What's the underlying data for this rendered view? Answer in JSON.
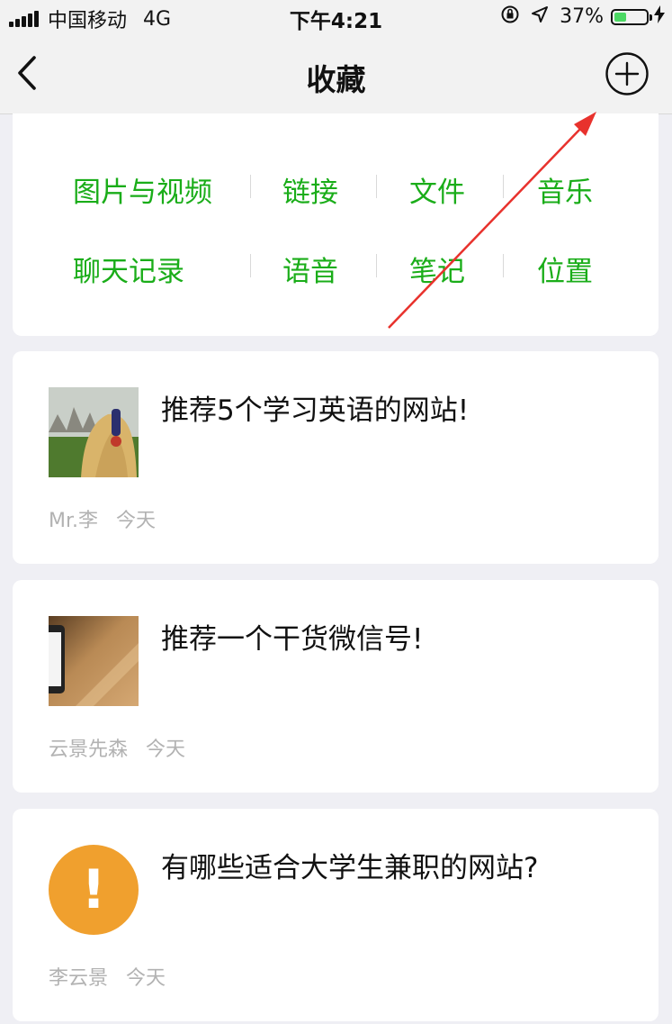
{
  "status_bar": {
    "carrier": "中国移动",
    "network": "4G",
    "time": "下午4:21",
    "battery_percent": "37%",
    "battery_level": 0.37,
    "icons": [
      "signal-icon",
      "orientation-lock-icon",
      "location-icon",
      "battery-icon",
      "charging-icon"
    ]
  },
  "nav": {
    "title": "收藏",
    "back_icon": "chevron-left-icon",
    "add_icon": "plus-circle-icon"
  },
  "categories": [
    "图片与视频",
    "链接",
    "文件",
    "音乐",
    "聊天记录",
    "语音",
    "笔记",
    "位置"
  ],
  "favorites": [
    {
      "title": "推荐5个学习英语的网站!",
      "author": "Mr.李",
      "date": "今天",
      "thumb": "photo-girl-headphones"
    },
    {
      "title": "推荐一个干货微信号!",
      "author": "云景先森",
      "date": "今天",
      "thumb": "photo-phone-on-wood"
    },
    {
      "title": "有哪些适合大学生兼职的网站?",
      "author": "李云景",
      "date": "今天",
      "thumb": "warning-icon",
      "thumb_symbol": "!"
    }
  ],
  "colors": {
    "accent_green": "#1aad19",
    "background": "#efeff4",
    "annotation_arrow": "#e8322d",
    "warning_orange": "#f0a02e"
  }
}
